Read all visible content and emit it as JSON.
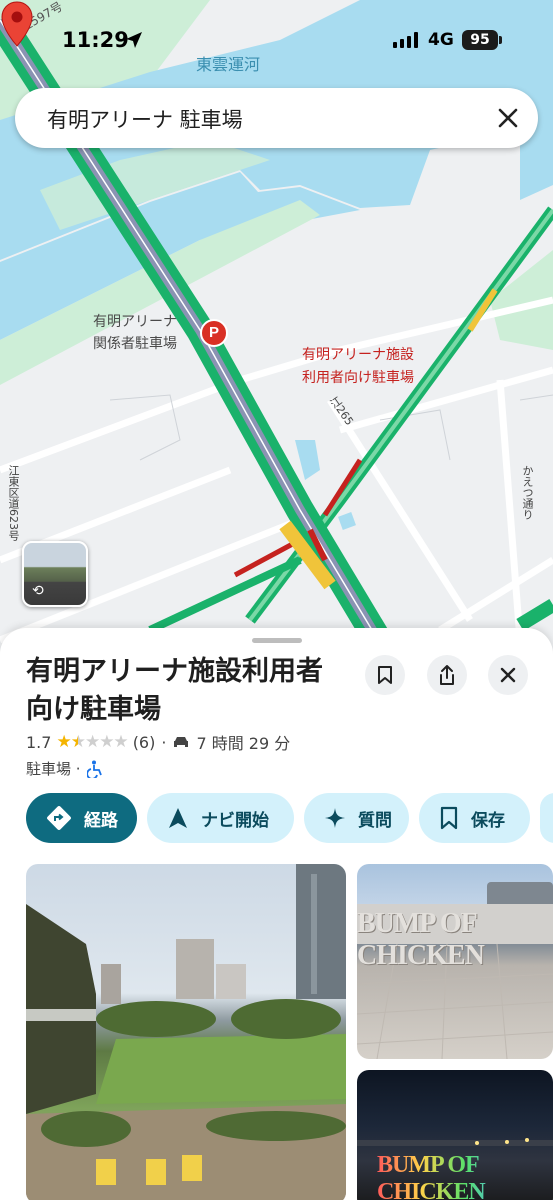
{
  "status_bar": {
    "time": "11:29",
    "network": "4G",
    "battery": "95"
  },
  "search": {
    "query": "有明アリーナ 駐車場"
  },
  "map": {
    "labels": {
      "canal": "東雲運河",
      "route_597": "江597号",
      "place_staff_parking_line1": "有明アリーナ",
      "place_staff_parking_line2": "関係者駐車場",
      "place_user_parking_line1": "有明アリーナ施設",
      "place_user_parking_line2": "利用者向け駐車場",
      "route_265": "江265",
      "koto_ward_road": "江東区道623号",
      "kaetsu_street": "かえつ通り"
    },
    "parking_pin": "P",
    "colors": {
      "water": "#a8dcf0",
      "park": "#cdeed7",
      "highway": "#1ab26b",
      "traffic_yellow": "#f0c43a",
      "traffic_red": "#c5221f"
    }
  },
  "place": {
    "title": "有明アリーナ施設利用者向け駐車場",
    "rating": "1.7",
    "stars_filled": 1.5,
    "stars_total": 5,
    "review_count": "(6)",
    "separator": "·",
    "drive_time": "7 時間 29 分",
    "category": "駐車場 ·",
    "accessibility_icon": "wheelchair-icon"
  },
  "actions": {
    "route": "経路",
    "navi": "ナビ開始",
    "ask": "質問",
    "save": "保存"
  },
  "photos": {
    "sign_text": "BUMP OF CHICKEN"
  }
}
